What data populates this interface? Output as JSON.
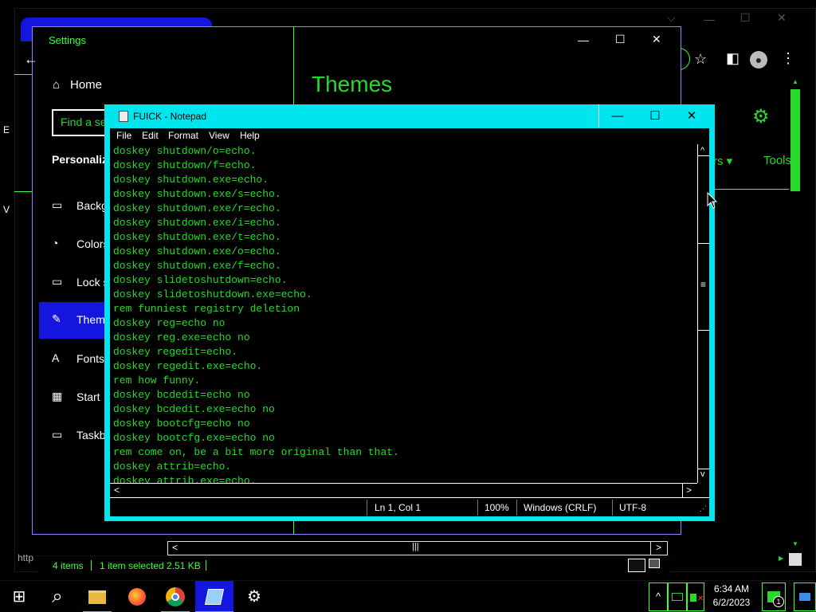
{
  "browser": {
    "window_controls": {
      "chevron": "⌵",
      "minimize": "—",
      "maximize": "☐",
      "close": "✕"
    },
    "toolbar_icons": {
      "star": "☆",
      "sidebar": "◧",
      "profile": "●",
      "menu": "⋮"
    },
    "gear": "⚙",
    "filters_label": "rs ▾",
    "tools_label": "Tools",
    "status_url": "http",
    "side_fragments": {
      "e": "E",
      "v": "V"
    },
    "scroll_up": "▲",
    "scroll_down": "▼",
    "scroll_right": "▶"
  },
  "explorer": {
    "items_count": "4 items",
    "selection": "1 item selected  2.51 KB",
    "scroll_left": "<",
    "scroll_right": ">",
    "scroll_thumb": "|||"
  },
  "settings": {
    "title": "Settings",
    "controls": {
      "minimize": "—",
      "maximize": "☐",
      "close": "✕"
    },
    "back_icon": "←",
    "home_label": "Home",
    "search_placeholder": "Find a se",
    "section": "Personaliz",
    "nav": [
      {
        "label": "Backg",
        "icon": "▭"
      },
      {
        "label": "Colors",
        "icon": "◔"
      },
      {
        "label": "Lock s",
        "icon": "▭"
      },
      {
        "label": "Them",
        "icon": "✎"
      },
      {
        "label": "Fonts",
        "icon": "A"
      },
      {
        "label": "Start",
        "icon": "▦"
      },
      {
        "label": "Taskb",
        "icon": "▭"
      }
    ],
    "heading": "Themes"
  },
  "notepad": {
    "title": "FUICK - Notepad",
    "controls": {
      "minimize": "—",
      "maximize": "☐",
      "close": "✕"
    },
    "menu": [
      "File",
      "Edit",
      "Format",
      "View",
      "Help"
    ],
    "lines": [
      "doskey shutdown/o=echo.",
      "doskey shutdown/f=echo.",
      "doskey shutdown.exe=echo.",
      "doskey shutdown.exe/s=echo.",
      "doskey shutdown.exe/r=echo.",
      "doskey shutdown.exe/i=echo.",
      "doskey shutdown.exe/t=echo.",
      "doskey shutdown.exe/o=echo.",
      "doskey shutdown.exe/f=echo.",
      "doskey slidetoshutdown=echo.",
      "doskey slidetoshutdown.exe=echo.",
      "rem funniest registry deletion",
      "doskey reg=echo no",
      "doskey reg.exe=echo no",
      "doskey regedit=echo.",
      "doskey regedit.exe=echo.",
      "rem how funny.",
      "doskey bcdedit=echo no",
      "doskey bcdedit.exe=echo no",
      "doskey bootcfg=echo no",
      "doskey bootcfg.exe=echo no",
      "rem come on, be a bit more original than that.",
      "doskey attrib=echo.",
      "doskey attrib.exe=echo."
    ],
    "scroll_up": "^",
    "scroll_down": "v",
    "scroll_left": "<",
    "scroll_right": ">",
    "scroll_thumb": "≡",
    "status": {
      "position": "Ln 1, Col 1",
      "zoom": "100%",
      "line_ending": "Windows (CRLF)",
      "encoding": "UTF-8"
    }
  },
  "taskbar": {
    "start_icon": "⊞",
    "search_icon": "⌕",
    "settings_glyph": "⚙",
    "tray_chevron": "^",
    "notification_count": "1",
    "time": "6:34 AM",
    "date": "6/2/2023"
  },
  "colors": {
    "accent_green": "#2ad82a",
    "accent_blue": "#1515e0",
    "notepad_frame": "#00e5ee"
  }
}
